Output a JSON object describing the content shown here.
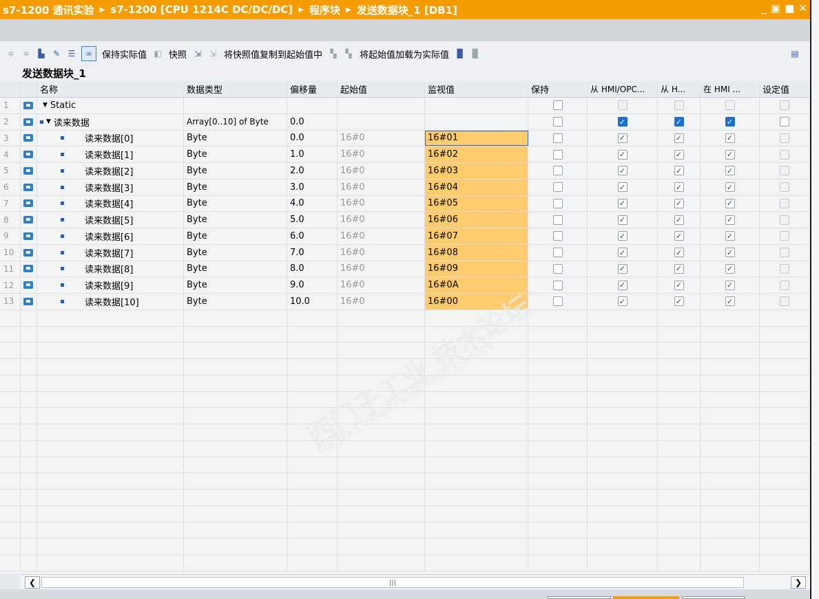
{
  "breadcrumb": [
    "s7-1200 通讯实验",
    "s7-1200 [CPU 1214C DC/DC/DC]",
    "程序块",
    "发送数据块_1 [DB1]"
  ],
  "window_controls": [
    "_",
    "▣",
    "■",
    "✕"
  ],
  "toolbar": {
    "keep_actual": "保持实际值",
    "snapshot": "快照",
    "copy_snapshot": "将快照值复制到起始值中",
    "load_start": "将起始值加载为实际值"
  },
  "block_title": "发送数据块_1",
  "headers": [
    "名称",
    "数据类型",
    "偏移量",
    "起始值",
    "监视值",
    "保持",
    "从 HMI/OPC...",
    "从 H...",
    "在 HMI ...",
    "设定值"
  ],
  "rows": [
    {
      "num": "1",
      "name": "Static",
      "type": "",
      "offset": "",
      "start": "",
      "monitor": ""
    },
    {
      "num": "2",
      "name": "读来数据",
      "type": "Array[0..10] of Byte",
      "offset": "0.0",
      "start": "",
      "monitor": ""
    },
    {
      "num": "3",
      "name": "读来数据[0]",
      "type": "Byte",
      "offset": "0.0",
      "start": "16#0",
      "monitor": "16#01"
    },
    {
      "num": "4",
      "name": "读来数据[1]",
      "type": "Byte",
      "offset": "1.0",
      "start": "16#0",
      "monitor": "16#02"
    },
    {
      "num": "5",
      "name": "读来数据[2]",
      "type": "Byte",
      "offset": "2.0",
      "start": "16#0",
      "monitor": "16#03"
    },
    {
      "num": "6",
      "name": "读来数据[3]",
      "type": "Byte",
      "offset": "3.0",
      "start": "16#0",
      "monitor": "16#04"
    },
    {
      "num": "7",
      "name": "读来数据[4]",
      "type": "Byte",
      "offset": "4.0",
      "start": "16#0",
      "monitor": "16#05"
    },
    {
      "num": "8",
      "name": "读来数据[5]",
      "type": "Byte",
      "offset": "5.0",
      "start": "16#0",
      "monitor": "16#06"
    },
    {
      "num": "9",
      "name": "读来数据[6]",
      "type": "Byte",
      "offset": "6.0",
      "start": "16#0",
      "monitor": "16#07"
    },
    {
      "num": "10",
      "name": "读来数据[7]",
      "type": "Byte",
      "offset": "7.0",
      "start": "16#0",
      "monitor": "16#08"
    },
    {
      "num": "11",
      "name": "读来数据[8]",
      "type": "Byte",
      "offset": "8.0",
      "start": "16#0",
      "monitor": "16#09"
    },
    {
      "num": "12",
      "name": "读来数据[9]",
      "type": "Byte",
      "offset": "9.0",
      "start": "16#0",
      "monitor": "16#0A"
    },
    {
      "num": "13",
      "name": "读来数据[10]",
      "type": "Byte",
      "offset": "10.0",
      "start": "16#0",
      "monitor": "16#00"
    }
  ],
  "scroll_grip": "|||",
  "watermark": "西门子工业 技术论坛",
  "watermark_url": "support.industry.siemens.com/cs",
  "colors": {
    "title_bar": "#f59c00",
    "monitor_cell": "#fecc6d",
    "checkbox_blue": "#1f6fd1"
  }
}
